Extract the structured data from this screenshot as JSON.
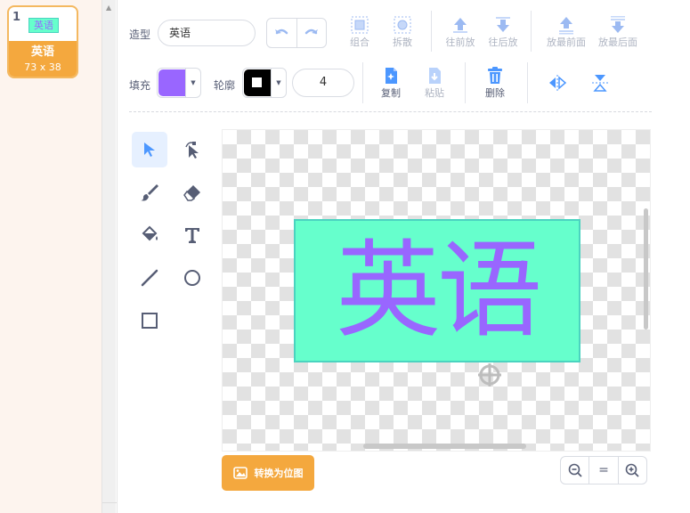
{
  "costume": {
    "number": "1",
    "thumb_text": "英语",
    "name": "英语",
    "size": "73 x 38"
  },
  "toolbar": {
    "costume_label": "造型",
    "costume_name": "英语",
    "group_label": "组合",
    "ungroup_label": "拆散",
    "forward_label": "往前放",
    "backward_label": "往后放",
    "front_label": "放最前面",
    "back_label": "放最后面",
    "fill_label": "填充",
    "outline_label": "轮廓",
    "stroke_width": "4",
    "copy_label": "复制",
    "paste_label": "粘贴",
    "delete_label": "删除"
  },
  "colors": {
    "fill": "#9966ff",
    "outline": "#000000",
    "accent": "#4c97ff",
    "text_box_bg": "#66ffcc"
  },
  "canvas": {
    "text": "英语"
  },
  "bottom": {
    "convert_label": "转换为位图",
    "zoom_reset": "="
  }
}
